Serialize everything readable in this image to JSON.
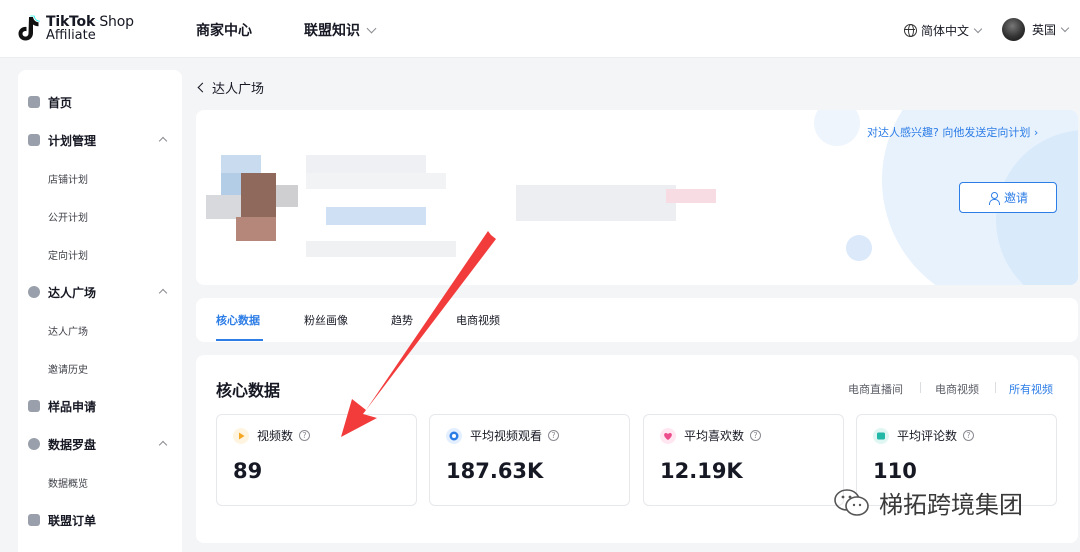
{
  "header": {
    "logo_line1_bold": "TikTok",
    "logo_line1_thin": " Shop",
    "logo_line2": "Affiliate",
    "nav": [
      "商家中心",
      "联盟知识"
    ],
    "language": "简体中文",
    "region": "英国"
  },
  "sidebar": {
    "groups": [
      {
        "label": "首页",
        "icon": "home-icon",
        "expanded": null,
        "items": []
      },
      {
        "label": "计划管理",
        "icon": "plan-icon",
        "expanded": true,
        "items": [
          "店铺计划",
          "公开计划",
          "定向计划"
        ]
      },
      {
        "label": "达人广场",
        "icon": "creator-icon",
        "expanded": true,
        "items": [
          "达人广场",
          "邀请历史"
        ]
      },
      {
        "label": "样品申请",
        "icon": "sample-icon",
        "expanded": null,
        "items": []
      },
      {
        "label": "数据罗盘",
        "icon": "compass-icon",
        "expanded": true,
        "items": [
          "数据概览"
        ]
      },
      {
        "label": "联盟订单",
        "icon": "order-icon",
        "expanded": null,
        "items": []
      }
    ]
  },
  "breadcrumb": {
    "back_label": "达人广场"
  },
  "profile": {
    "promo_text": "对达人感兴趣? 向他发送定向计划",
    "invite_label": "邀请"
  },
  "tabs": [
    {
      "label": "核心数据",
      "active": true
    },
    {
      "label": "粉丝画像",
      "active": false
    },
    {
      "label": "趋势",
      "active": false
    },
    {
      "label": "电商视频",
      "active": false
    }
  ],
  "core_data": {
    "title": "核心数据",
    "filters": [
      {
        "label": "电商直播间",
        "active": false
      },
      {
        "label": "电商视频",
        "active": false
      },
      {
        "label": "所有视频",
        "active": true
      }
    ],
    "metrics": [
      {
        "label": "视频数",
        "value": "89",
        "icon": "play-icon",
        "color": "#f5a623",
        "bg": "#fff4e0"
      },
      {
        "label": "平均视频观看",
        "value": "187.63K",
        "icon": "eye-icon",
        "color": "#2d7de6",
        "bg": "#e3efff"
      },
      {
        "label": "平均喜欢数",
        "value": "12.19K",
        "icon": "heart-icon",
        "color": "#ec4c8c",
        "bg": "#ffe6f0"
      },
      {
        "label": "平均评论数",
        "value": "110",
        "icon": "comment-icon",
        "color": "#22b8a8",
        "bg": "#dff6f3"
      }
    ]
  },
  "watermark": {
    "text": "梯拓跨境集团"
  },
  "colors": {
    "accent": "#2d7de6",
    "annotation_arrow": "#f23c3c"
  }
}
